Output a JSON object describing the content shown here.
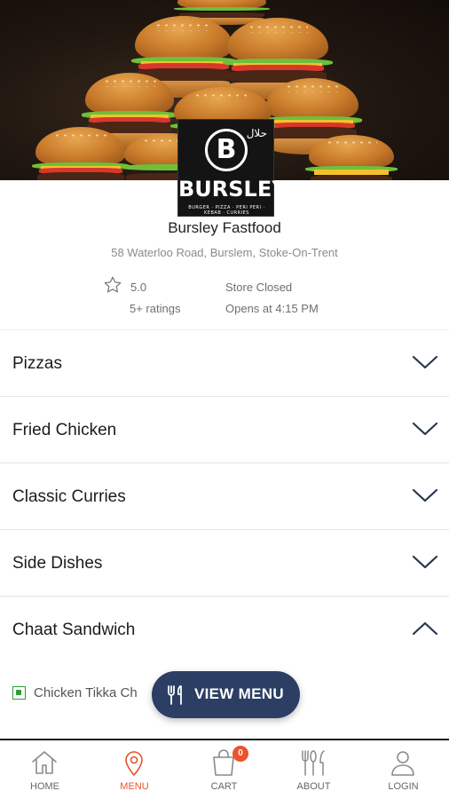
{
  "store": {
    "logo_word": "BURSLEY",
    "logo_tagline": "BURGER · PIZZA · PERI PERI · KEBAB · CURRIES",
    "logo_halal": "حلال",
    "name": "Bursley Fastfood",
    "address": "58 Waterloo Road, Burslem, Stoke-On-Trent",
    "rating": "5.0",
    "rating_count": "5+ ratings",
    "status": "Store Closed",
    "opens": "Opens at 4:15 PM"
  },
  "categories": [
    {
      "label": "Pizzas",
      "expanded": false
    },
    {
      "label": "Fried Chicken",
      "expanded": false
    },
    {
      "label": "Classic Curries",
      "expanded": false
    },
    {
      "label": "Side Dishes",
      "expanded": false
    },
    {
      "label": "Chaat Sandwich",
      "expanded": true
    }
  ],
  "chaat_items": [
    {
      "label": "Chicken Tikka Ch",
      "veg_indicator": "green"
    }
  ],
  "view_menu": {
    "label": "VIEW MENU",
    "icon": "cutlery-icon"
  },
  "nav": {
    "items": [
      {
        "label": "HOME",
        "icon": "home-icon",
        "active": false
      },
      {
        "label": "MENU",
        "icon": "location-pin-icon",
        "active": true
      },
      {
        "label": "CART",
        "icon": "shopping-bag-icon",
        "active": false,
        "badge": "0"
      },
      {
        "label": "ABOUT",
        "icon": "fork-knife-icon",
        "active": false
      },
      {
        "label": "LOGIN",
        "icon": "user-icon",
        "active": false
      }
    ]
  },
  "colors": {
    "accent": "#e8542d",
    "button": "#2c3e63",
    "veg": "#2e9b3a"
  }
}
